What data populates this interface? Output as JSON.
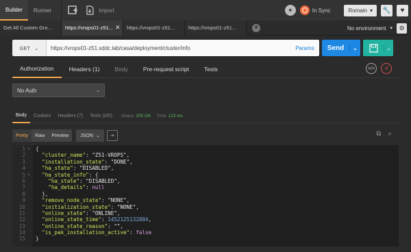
{
  "topbar": {
    "tab_builder": "Builder",
    "tab_runner": "Runner",
    "import_label": "Import",
    "sync_label": "In Sync",
    "user_label": "Romain"
  },
  "tabs": [
    {
      "label": "Get All Custom Gro...",
      "active": false,
      "closable": false
    },
    {
      "label": "https://vrops01-z51...",
      "active": true,
      "closable": true
    },
    {
      "label": "https://vrops01-z51...",
      "active": false,
      "closable": false
    },
    {
      "label": "https://vrops01-z51...",
      "active": false,
      "closable": false
    }
  ],
  "environment": {
    "label": "No environment"
  },
  "request": {
    "method": "GET",
    "url": "https://vrops01-z51.sddc.lab/casa/deployment/cluster/info",
    "params_label": "Params",
    "send_label": "Send"
  },
  "request_tabs": [
    {
      "label": "Authorization",
      "active": true,
      "dim": false
    },
    {
      "label": "Headers (1)",
      "active": false,
      "dim": false
    },
    {
      "label": "Body",
      "active": false,
      "dim": true
    },
    {
      "label": "Pre-request script",
      "active": false,
      "dim": false
    },
    {
      "label": "Tests",
      "active": false,
      "dim": false
    }
  ],
  "auth": {
    "selected": "No Auth"
  },
  "response_tabs": [
    {
      "label": "Body",
      "active": true
    },
    {
      "label": "Cookies",
      "active": false
    },
    {
      "label": "Headers (7)",
      "active": false
    },
    {
      "label": "Tests (0/0)",
      "active": false
    }
  ],
  "response_status": {
    "status_label": "Status",
    "status_value": "200 OK",
    "time_label": "Time",
    "time_value": "123 ms"
  },
  "view_modes": [
    "Pretty",
    "Raw",
    "Preview"
  ],
  "active_view": "Pretty",
  "format": "JSON",
  "response_lines": [
    {
      "n": "1",
      "fold": "▾",
      "text": "{"
    },
    {
      "n": "2",
      "fold": "",
      "key": "cluster_name",
      "val": "\"Z51-VROPS\"",
      "type": "str",
      "indent": 1
    },
    {
      "n": "3",
      "fold": "",
      "key": "installation_state",
      "val": "\"DONE\"",
      "type": "str",
      "indent": 1
    },
    {
      "n": "4",
      "fold": "",
      "key": "ha_state",
      "val": "\"DISABLED\"",
      "type": "str",
      "indent": 1
    },
    {
      "n": "5",
      "fold": "▾",
      "key": "ha_state_info",
      "val": "{",
      "type": "open",
      "indent": 1
    },
    {
      "n": "6",
      "fold": "",
      "key": "ha_state",
      "val": "\"DISABLED\"",
      "type": "str",
      "indent": 2
    },
    {
      "n": "7",
      "fold": "",
      "key": "ha_details",
      "val": "null",
      "type": "kw",
      "indent": 2
    },
    {
      "n": "8",
      "fold": "",
      "text": "},",
      "indent": 1
    },
    {
      "n": "9",
      "fold": "",
      "key": "remove_node_state",
      "val": "\"NONE\"",
      "type": "str",
      "indent": 1
    },
    {
      "n": "10",
      "fold": "",
      "key": "initialization_state",
      "val": "\"NONE\"",
      "type": "str",
      "indent": 1
    },
    {
      "n": "11",
      "fold": "",
      "key": "online_state",
      "val": "\"ONLINE\"",
      "type": "str",
      "indent": 1
    },
    {
      "n": "12",
      "fold": "",
      "key": "online_state_time",
      "val": "1452125132884",
      "type": "num",
      "indent": 1
    },
    {
      "n": "13",
      "fold": "",
      "key": "online_state_reason",
      "val": "\"\"",
      "type": "str",
      "indent": 1
    },
    {
      "n": "14",
      "fold": "",
      "key": "is_pak_installation_active",
      "val": "false",
      "type": "kw",
      "indent": 1,
      "last": true
    },
    {
      "n": "15",
      "fold": "",
      "text": "}"
    }
  ]
}
